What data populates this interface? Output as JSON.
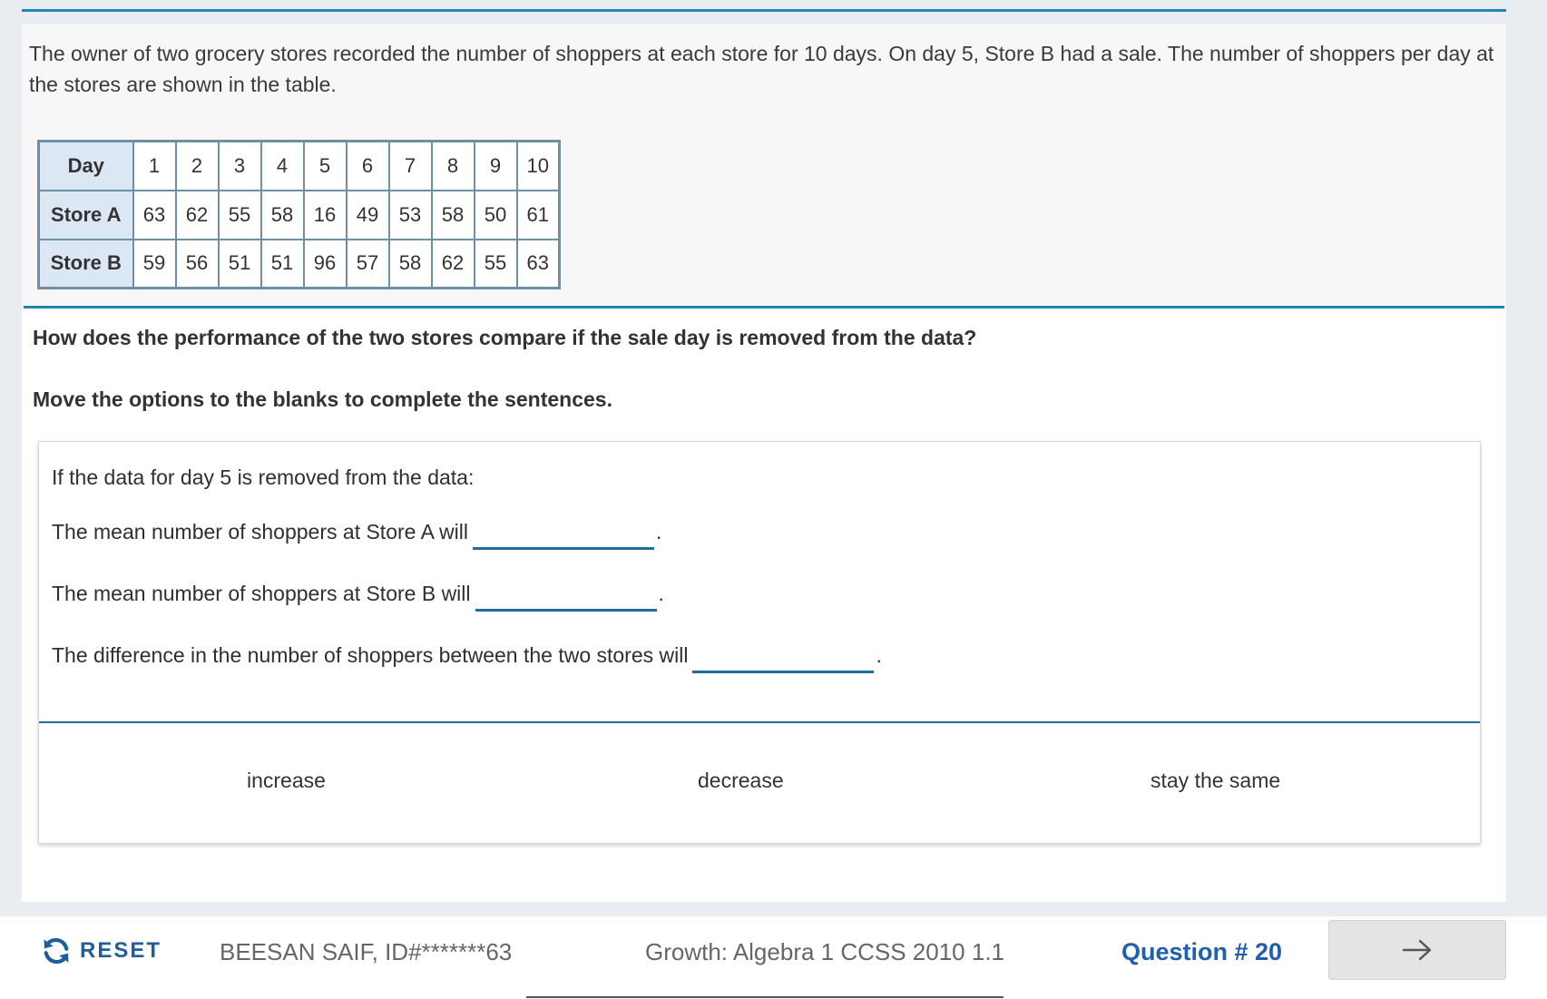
{
  "stimulus": {
    "text": "The owner of two grocery stores recorded the number of shoppers at each store for 10 days. On day 5, Store B had a sale. The number of shoppers per day at the stores are shown in the table."
  },
  "table": {
    "row_headers": [
      "Day",
      "Store A",
      "Store B"
    ],
    "days": [
      "1",
      "2",
      "3",
      "4",
      "5",
      "6",
      "7",
      "8",
      "9",
      "10"
    ],
    "store_a": [
      "63",
      "62",
      "55",
      "58",
      "16",
      "49",
      "53",
      "58",
      "50",
      "61"
    ],
    "store_b": [
      "59",
      "56",
      "51",
      "51",
      "96",
      "57",
      "58",
      "62",
      "55",
      "63"
    ]
  },
  "question": "How does the performance of the two stores compare if the sale day is removed from the data?",
  "instruction": "Move the options to the blanks to complete the sentences.",
  "panel": {
    "intro": "If the data for day 5 is removed from the data:",
    "sentence_1": "The mean number of shoppers at Store A will",
    "sentence_2": "The mean number of shoppers at Store B will",
    "sentence_3": "The difference in the number of shoppers between the two stores will",
    "period": "."
  },
  "options": [
    "increase",
    "decrease",
    "stay the same"
  ],
  "footer": {
    "reset_label": "RESET",
    "student": "BEESAN SAIF, ID#*******63",
    "course": "Growth: Algebra 1 CCSS 2010 1.1",
    "question_number": "Question # 20"
  },
  "icons": {
    "reset": "refresh-icon",
    "next": "arrow-right-icon"
  },
  "colors": {
    "accent_blue": "#1f5fae",
    "rule_blue": "#1e87b5",
    "table_header_bg": "#dbe8f4"
  }
}
